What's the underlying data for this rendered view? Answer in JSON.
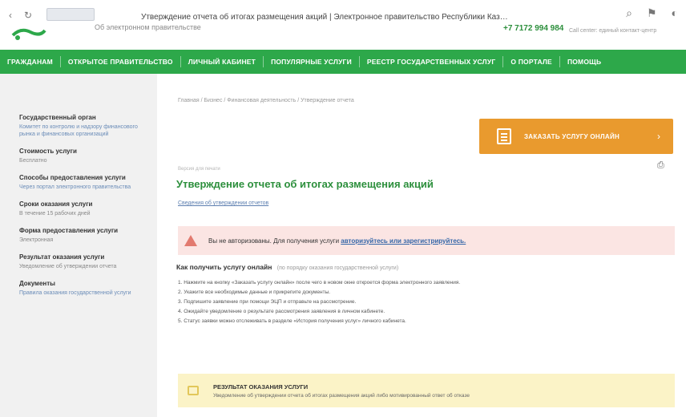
{
  "window": {
    "title": "Утверждение отчета об итогах размещения акций | Электронное правительство Республики Казахстан",
    "site_link": "Об электронном правительстве",
    "phone": "+7 7172 994 984",
    "help_note": "Call center: единый контакт-центр"
  },
  "menu": [
    "ГРАЖДАНАМ",
    "ОТКРЫТОЕ ПРАВИТЕЛЬСТВО",
    "ЛИЧНЫЙ КАБИНЕТ",
    "ПОПУЛЯРНЫЕ УСЛУГИ",
    "РЕЕСТР ГОСУДАРСТВЕННЫХ УСЛУГ",
    "О ПОРТАЛЕ",
    "ПОМОЩЬ"
  ],
  "sidebar": [
    {
      "head": "Государственный орган",
      "body": "Комитет по контролю и надзору финансового рынка и финансовых организаций"
    },
    {
      "head": "Стоимость услуги",
      "body": "Бесплатно"
    },
    {
      "head": "Способы предоставления услуги",
      "body": "Через портал электронного правительства"
    },
    {
      "head": "Сроки оказания услуги",
      "body": "В течение 15 рабочих дней"
    },
    {
      "head": "Форма предоставления услуги",
      "body": "Электронная"
    },
    {
      "head": "Результат оказания услуги",
      "body": "Уведомление об утверждении отчета"
    },
    {
      "head": "Документы",
      "body": "Правила оказания государственной услуги"
    }
  ],
  "main": {
    "breadcrumb": "Главная / Бизнес / Финансовая деятельность / Утверждение отчета",
    "order_button": "ЗАКАЗАТЬ УСЛУГУ ОНЛАЙН",
    "small_link": "Версия для печати",
    "title": "Утверждение отчета об итогах размещения акций",
    "sub_link": "Сведения об утверждении отчетов",
    "alert_text": "Вы не авторизованы. Для получения услуги",
    "alert_link": "авторизуйтесь или зарегистрируйтесь.",
    "how_head": "Как получить услугу онлайн",
    "how_note": "(по порядку оказания государственной услуги)",
    "steps": [
      "1. Нажмите на кнопку «Заказать услугу онлайн» после чего в новом окне откроется форма электронного заявления.",
      "2. Укажите все необходимые данные и прикрепите документы.",
      "3. Подпишите заявление при помощи ЭЦП и отправьте на рассмотрение.",
      "4. Ожидайте уведомление о результате рассмотрения заявления в личном кабинете.",
      "5. Статус заявки можно отслеживать в разделе «История получения услуг» личного кабинета."
    ],
    "result_head": "РЕЗУЛЬТАТ ОКАЗАНИЯ УСЛУГИ",
    "result_body": "Уведомление об утверждении отчета об итогах размещения акций либо мотивированный ответ об отказе"
  }
}
